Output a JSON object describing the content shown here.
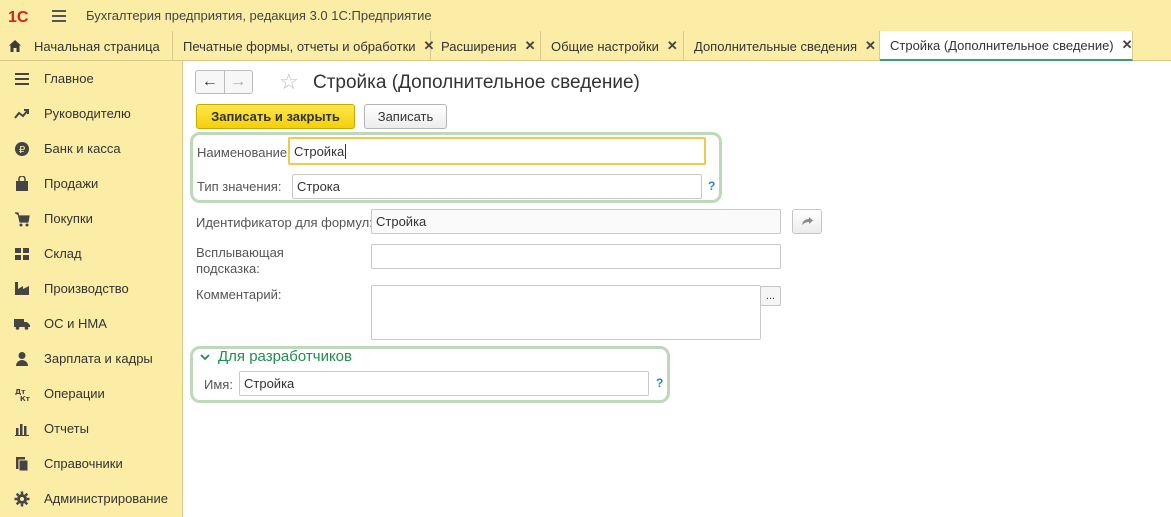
{
  "app": {
    "title": "Бухгалтерия предприятия, редакция 3.0 1С:Предприятие",
    "logo_text": "1С"
  },
  "tabs": [
    {
      "label": "Начальная страница",
      "closable": false,
      "active": false
    },
    {
      "label": "Печатные формы, отчеты и обработки",
      "closable": true,
      "active": false
    },
    {
      "label": "Расширения",
      "closable": true,
      "active": false
    },
    {
      "label": "Общие настройки",
      "closable": true,
      "active": false
    },
    {
      "label": "Дополнительные сведения",
      "closable": true,
      "active": false
    },
    {
      "label": "Стройка (Дополнительное сведение)",
      "closable": true,
      "active": true
    }
  ],
  "tab_close_glyph": "✕",
  "sidebar": {
    "items": [
      {
        "label": "Главное",
        "icon": "menu-list-icon"
      },
      {
        "label": "Руководителю",
        "icon": "trend-icon"
      },
      {
        "label": "Банк и касса",
        "icon": "ruble-coin-icon"
      },
      {
        "label": "Продажи",
        "icon": "shopping-bag-icon"
      },
      {
        "label": "Покупки",
        "icon": "cart-icon"
      },
      {
        "label": "Склад",
        "icon": "warehouse-grid-icon"
      },
      {
        "label": "Производство",
        "icon": "factory-icon"
      },
      {
        "label": "ОС и НМА",
        "icon": "truck-icon"
      },
      {
        "label": "Зарплата и кадры",
        "icon": "person-icon"
      },
      {
        "label": "Операции",
        "icon": "debit-credit-icon"
      },
      {
        "label": "Отчеты",
        "icon": "bar-chart-icon"
      },
      {
        "label": "Справочники",
        "icon": "books-icon"
      },
      {
        "label": "Администрирование",
        "icon": "gear-icon"
      }
    ]
  },
  "form": {
    "title": "Стройка (Дополнительное сведение)",
    "nav_back": "←",
    "nav_forward": "→",
    "favorite_glyph": "☆",
    "buttons": {
      "save_close": "Записать и закрыть",
      "save": "Записать"
    },
    "fields": {
      "name_label": "Наименование:",
      "name_value": "Стройка",
      "type_label": "Тип значения:",
      "type_value": "Строка",
      "formula_id_label": "Идентификатор для формул:",
      "formula_id_value": "Стройка",
      "tooltip_label_line1": "Всплывающая",
      "tooltip_label_line2": "подсказка:",
      "tooltip_value": "",
      "comment_label": "Комментарий:",
      "comment_value": ""
    },
    "help_glyph": "?",
    "dots_glyph": "...",
    "developer_section": {
      "title": "Для разработчиков",
      "name_label": "Имя:",
      "name_value": "Стройка"
    }
  },
  "colors": {
    "chrome_bg": "#fbeca6",
    "primary_button": "#f4cf0a",
    "highlight_border": "#bdd9b9",
    "section_title": "#1f8e52",
    "help_link": "#2a7fd1",
    "focus_border": "#f2c94c"
  }
}
